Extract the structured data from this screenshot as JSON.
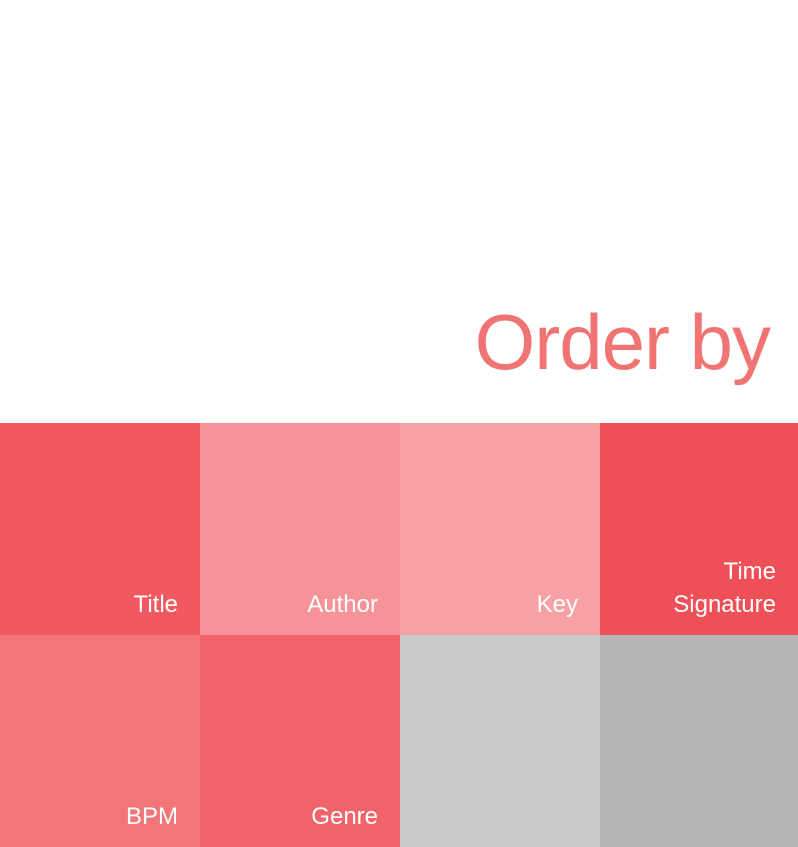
{
  "header": {
    "title": "Order by",
    "title_color": "#ef7473"
  },
  "tiles": [
    {
      "label": "Title",
      "color": "#f25860"
    },
    {
      "label": "Author",
      "color": "#f59398"
    },
    {
      "label": "Key",
      "color": "#f7a1a5"
    },
    {
      "label": "Time\nSignature",
      "color": "#ef4f56"
    },
    {
      "label": "BPM",
      "color": "#f27577"
    },
    {
      "label": "Genre",
      "color": "#f2646c"
    },
    {
      "label": "",
      "color": "#cbcbcb"
    },
    {
      "label": "",
      "color": "#b5b5b5"
    }
  ]
}
